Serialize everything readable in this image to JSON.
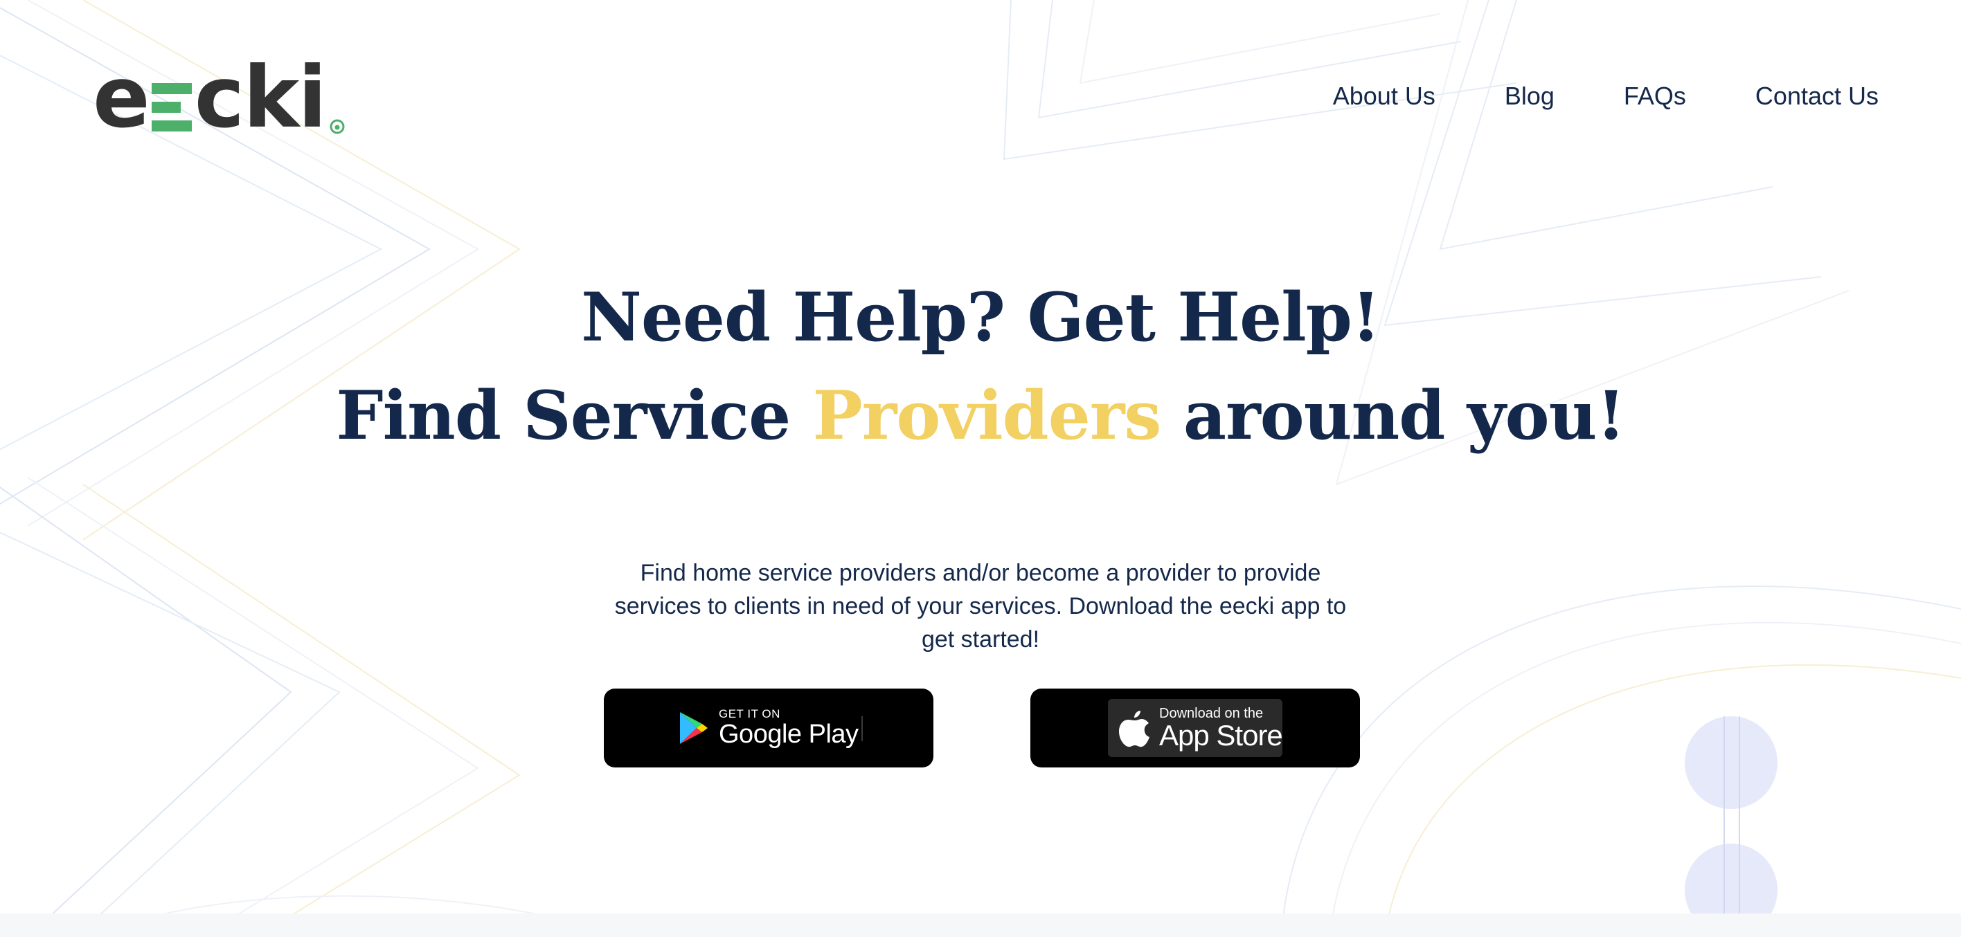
{
  "brand": {
    "logo_prefix": "e",
    "logo_suffix": "cki",
    "logo_bar_color": "#4caf6a",
    "logo_text_color": "#333333"
  },
  "nav": {
    "items": [
      {
        "label": "About Us"
      },
      {
        "label": "Blog"
      },
      {
        "label": "FAQs"
      },
      {
        "label": "Contact Us"
      }
    ]
  },
  "hero": {
    "line1": "Need Help? Get Help!",
    "line2_before": "Find Service ",
    "line2_accent": "Providers",
    "line2_after": " around you!",
    "description": "Find home service providers and/or become a provider to provide services to clients in need of your services. Download the eecki app to get started!"
  },
  "stores": {
    "google_play": {
      "small": "GET IT ON",
      "big": "Google Play",
      "icon": "google-play-icon"
    },
    "app_store": {
      "small": "Download on the",
      "big": "App Store",
      "icon": "apple-icon"
    }
  },
  "colors": {
    "primary_text": "#14284b",
    "accent": "#f2d061",
    "logo_green": "#4caf6a",
    "button_bg": "#000000"
  }
}
